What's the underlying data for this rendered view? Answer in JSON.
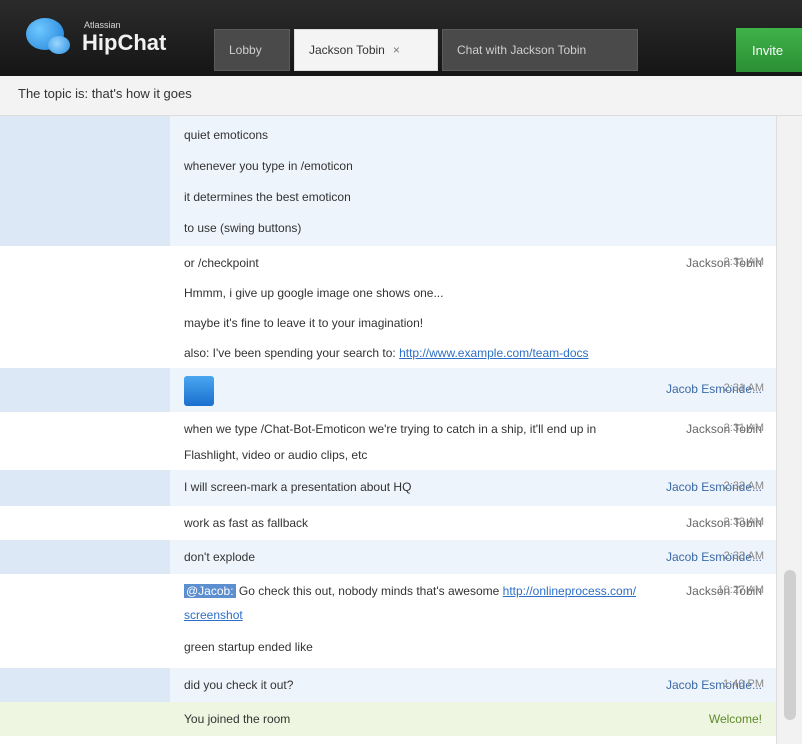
{
  "header": {
    "logo_small": "Atlassian",
    "logo_text": "HipChat",
    "tabs": [
      {
        "label": "Lobby"
      },
      {
        "label": "Jackson Tobin"
      },
      {
        "label": "Chat with Jackson Tobin"
      }
    ],
    "close_glyph": "×",
    "action_button": "Invite"
  },
  "topic": {
    "text": "The topic is: that's how it goes"
  },
  "messages": [
    {
      "sender": "",
      "lines": [
        "quiet emoticons",
        "whenever you type in /emoticon",
        "it determines the best emoticon",
        "to use (swing buttons)"
      ],
      "time": ""
    },
    {
      "sender": "Jackson Tobin",
      "lines": [
        "or /checkpoint",
        "Hmmm, i give up google image one shows one...",
        "maybe it's fine to leave it to your imagination!",
        "also: I've been spending your search to: "
      ],
      "link": "http://www.example.com/team-docs",
      "time": "2:31 AM"
    },
    {
      "sender": "Jacob Esmonde...",
      "lines": [],
      "time": "2:31 AM"
    },
    {
      "sender": "Jackson Tobin",
      "lines": [
        "when we type /Chat-Bot-Emoticon we're trying to catch in a ship, it'll end up in",
        "Flashlight, video or audio clips, etc"
      ],
      "time": "2:31 AM"
    },
    {
      "sender": "Jacob Esmonde...",
      "lines": [
        "I will screen-mark a presentation about HQ"
      ],
      "time": "2:32 AM"
    },
    {
      "sender": "Jackson Tobin",
      "lines": [
        "work as fast as fallback"
      ],
      "time": "2:33 AM"
    },
    {
      "sender": "Jacob Esmonde...",
      "lines": [
        "don't explode"
      ],
      "time": "2:33 AM"
    },
    {
      "sender": "Jackson Tobin",
      "highlight": "@Jacob:",
      "lines": [
        "Go check this out, nobody minds that's awesome ",
        "screenshot",
        "green startup ended like"
      ],
      "link": "http://onlineprocess.com/",
      "time": "10:27 AM"
    },
    {
      "sender": "Jacob Esmonde...",
      "lines": [
        "did you check it out?"
      ],
      "time": "1:40 PM"
    },
    {
      "sender": "Welcome!",
      "lines": [
        "You joined the room"
      ],
      "time": ""
    }
  ],
  "icons": {
    "chat_bubble": "chat-bubble-logo-icon",
    "image": "image-thumbnail-icon"
  }
}
